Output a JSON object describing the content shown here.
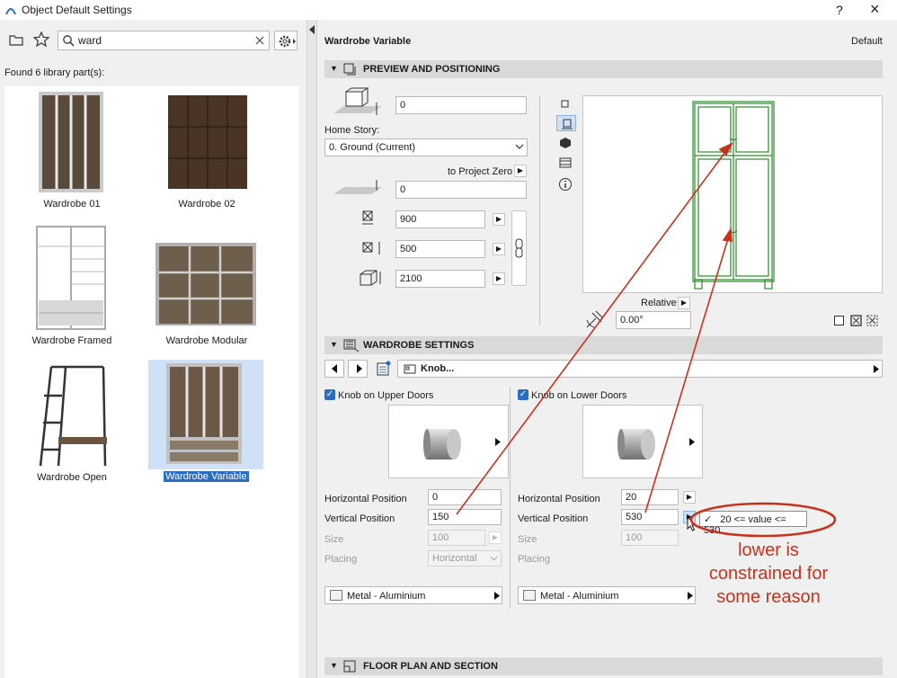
{
  "window": {
    "title": "Object Default Settings",
    "help": "?",
    "close": "×"
  },
  "left": {
    "search_value": "ward",
    "found_label": "Found 6 library part(s):",
    "items": [
      {
        "label": "Wardrobe 01"
      },
      {
        "label": "Wardrobe 02"
      },
      {
        "label": "Wardrobe Framed"
      },
      {
        "label": "Wardrobe Modular"
      },
      {
        "label": "Wardrobe Open"
      },
      {
        "label": "Wardrobe Variable",
        "selected": true
      }
    ]
  },
  "header": {
    "title": "Wardrobe Variable",
    "default": "Default"
  },
  "preview_section": {
    "title": "PREVIEW AND POSITIONING",
    "elevation_value": "0",
    "home_story_label": "Home Story:",
    "home_story_value": "0. Ground (Current)",
    "to_project_zero": "to Project Zero",
    "project_zero_value": "0",
    "width_value": "900",
    "depth_value": "500",
    "height_value": "2100",
    "relative_label": "Relative",
    "angle_value": "0.00°"
  },
  "wardrobe_section": {
    "title": "WARDROBE SETTINGS",
    "nav_label": "Knob...",
    "upper": {
      "checkbox_label": "Knob on Upper Doors",
      "horizontal_label": "Horizontal Position",
      "horizontal_value": "0",
      "vertical_label": "Vertical Position",
      "vertical_value": "150",
      "size_label": "Size",
      "size_value": "100",
      "placing_label": "Placing",
      "placing_value": "Horizontal",
      "material": "Metal - Aluminium"
    },
    "lower": {
      "checkbox_label": "Knob on Lower Doors",
      "horizontal_label": "Horizontal Position",
      "horizontal_value": "20",
      "vertical_label": "Vertical Position",
      "vertical_value": "530",
      "size_label": "Size",
      "size_value": "100",
      "placing_label": "Placing",
      "material": "Metal - Aluminium"
    },
    "tooltip": "20 <= value <= 530"
  },
  "floor_section": {
    "title": "FLOOR PLAN AND SECTION"
  },
  "annotation": {
    "line1": "lower is",
    "line2": "constrained for",
    "line3": "some reason"
  },
  "colors": {
    "accent": "#2b6cc4",
    "annotation": "#c8321d",
    "preview_green": "#2a8c2a"
  }
}
